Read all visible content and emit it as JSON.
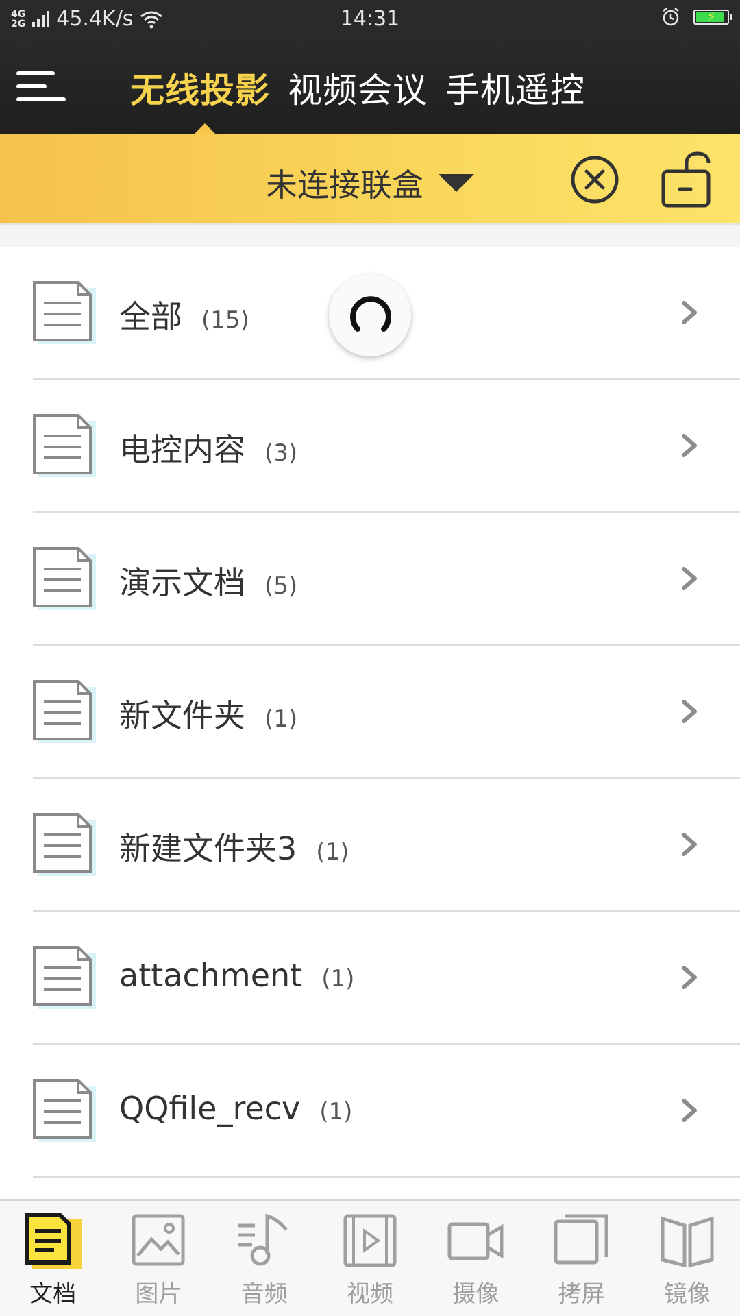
{
  "status_bar": {
    "network_top": "4G",
    "network_bottom": "2G",
    "speed": "45.4K/s",
    "time": "14:31"
  },
  "header": {
    "tabs": [
      {
        "label": "无线投影",
        "active": true
      },
      {
        "label": "视频会议",
        "active": false
      },
      {
        "label": "手机遥控",
        "active": false
      }
    ]
  },
  "connection": {
    "status_label": "未连接联盒"
  },
  "folders": [
    {
      "name": "全部",
      "count": "(15)"
    },
    {
      "name": "电控内容",
      "count": "(3)"
    },
    {
      "name": "演示文档",
      "count": "(5)"
    },
    {
      "name": "新文件夹",
      "count": "(1)"
    },
    {
      "name": "新建文件夹3",
      "count": "(1)"
    },
    {
      "name": "attachment",
      "count": "(1)"
    },
    {
      "name": "QQfile_recv",
      "count": "(1)"
    }
  ],
  "bottom_nav": [
    {
      "label": "文档",
      "icon": "document-icon",
      "active": true
    },
    {
      "label": "图片",
      "icon": "image-icon",
      "active": false
    },
    {
      "label": "音频",
      "icon": "music-icon",
      "active": false
    },
    {
      "label": "视频",
      "icon": "video-file-icon",
      "active": false
    },
    {
      "label": "摄像",
      "icon": "camera-icon",
      "active": false
    },
    {
      "label": "拷屏",
      "icon": "screen-copy-icon",
      "active": false
    },
    {
      "label": "镜像",
      "icon": "mirror-icon",
      "active": false
    }
  ],
  "colors": {
    "accent": "#f6d24d",
    "header_bg": "#2a2a2a",
    "connection_bar": "#f9d85c",
    "icon_fill": "#d9f3f7",
    "icon_stroke": "#8a8a8a"
  }
}
